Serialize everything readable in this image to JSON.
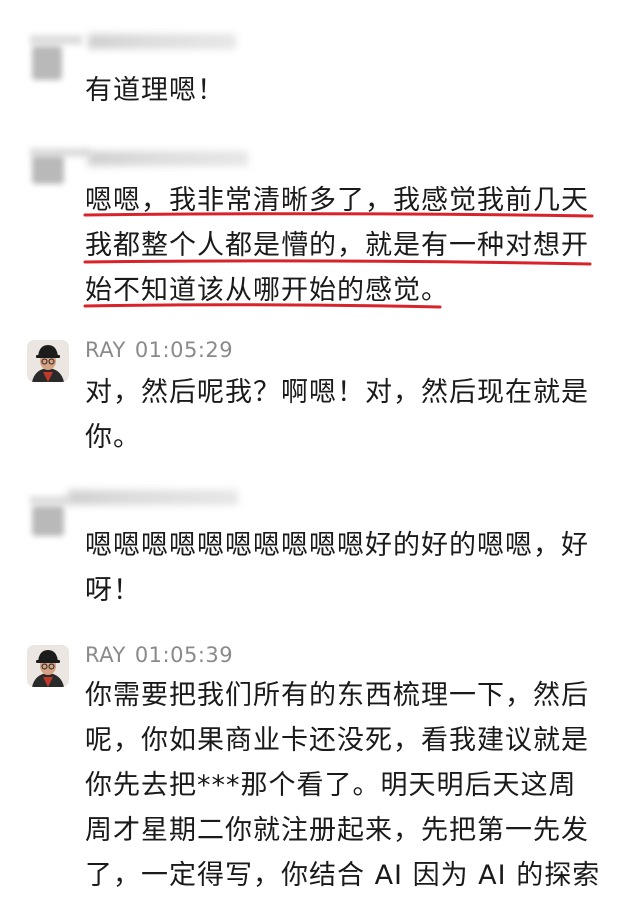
{
  "messages": [
    {
      "sender_redacted": true,
      "lines": [
        "有道理嗯！"
      ]
    },
    {
      "sender_redacted": true,
      "underlined": true,
      "lines": [
        "嗯嗯，我非常清晰多了，我感觉我前几天",
        "我都整个人都是懵的，就是有一种对想开",
        "始不知道该从哪开始的感觉。"
      ]
    },
    {
      "sender": "RAY",
      "time": "01:05:29",
      "avatar_icon": "user-photo-avatar",
      "lines": [
        "对，然后呢我？啊嗯！对，然后现在就是",
        "你。"
      ]
    },
    {
      "sender_redacted": true,
      "lines": [
        "嗯嗯嗯嗯嗯嗯嗯嗯嗯嗯好的好的嗯嗯，好",
        "呀！"
      ]
    },
    {
      "sender": "RAY",
      "time": "01:05:39",
      "avatar_icon": "user-photo-avatar",
      "lines": [
        "你需要把我们所有的东西梳理一下，然后",
        "呢，你如果商业卡还没死，看我建议就是",
        "你先去把***那个看了。明天明后天这周",
        "周才星期二你就注册起来，先把第一先发",
        "了，一定得写，你结合 AI 因为 AI 的探索"
      ]
    }
  ],
  "colors": {
    "background": "#ffffff",
    "text": "#1a1a1a",
    "meta": "#8a8a8a",
    "highlight": "#d8232a"
  }
}
